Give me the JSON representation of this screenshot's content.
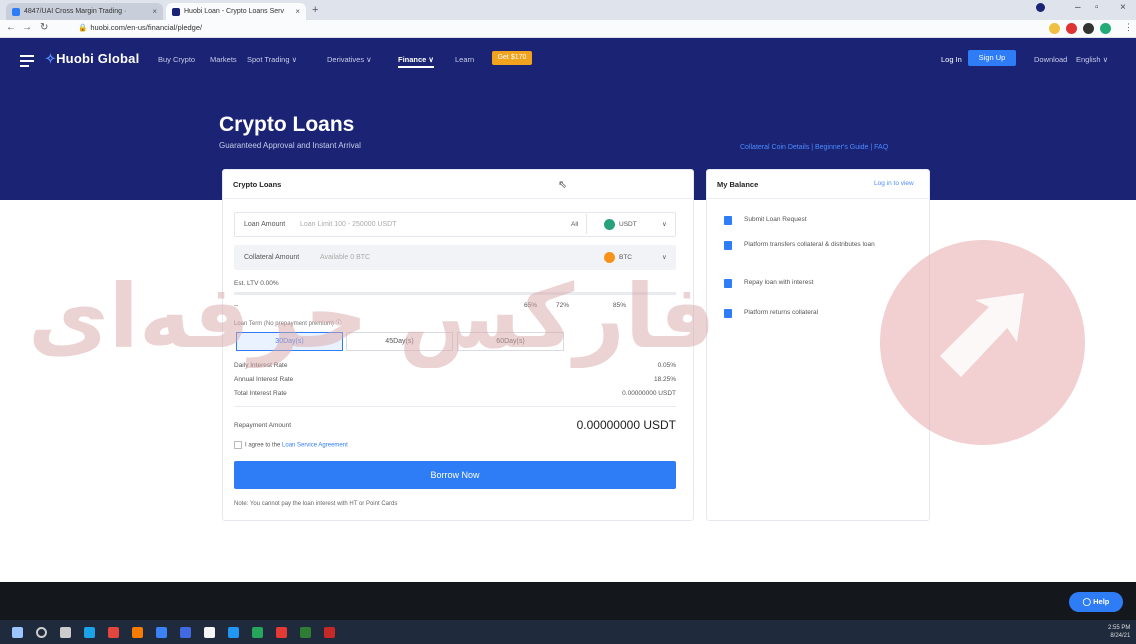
{
  "browser": {
    "tabs": [
      {
        "title": "4847/UAI Cross Margin Trading · ",
        "favicon_color": "#2f7df6"
      },
      {
        "title": "Huobi Loan - Crypto Loans Serv",
        "favicon_color": "#1a2374"
      }
    ],
    "url": "huobi.com/en-us/financial/pledge/"
  },
  "header": {
    "logo_main": "Huobi",
    "logo_sub": "Global",
    "nav": [
      "Buy Crypto",
      "Markets",
      "Spot Trading ∨",
      "Derivatives ∨",
      "Finance ∨",
      "Learn"
    ],
    "get_btn": "Get $170",
    "login": "Log In",
    "signup": "Sign Up",
    "download": "Download",
    "language": "English ∨"
  },
  "hero": {
    "title": "Crypto Loans",
    "subtitle": "Guaranteed Approval and Instant Arrival",
    "links": "Collateral Coin Details  |  Beginner's Guide  |  FAQ"
  },
  "loan_card": {
    "title": "Crypto Loans",
    "loan_label": "Loan Amount",
    "loan_placeholder": "Loan Limit 100 - 250000 USDT",
    "loan_all": "All",
    "loan_coin": "USDT",
    "collateral_label": "Collateral Amount",
    "collateral_placeholder": "Available 0 BTC",
    "collateral_coin": "BTC",
    "ltv_label": "Est. LTV 0.00%",
    "slider_left": "--",
    "slider_marks": [
      "65%",
      "72%",
      "85%"
    ],
    "loan_term_label": "Loan Term (No prepayment premium) ⓘ",
    "terms": [
      "30Day(s)",
      "45Day(s)",
      "60Day(s)"
    ],
    "rows": [
      {
        "label": "Daily Interest Rate",
        "value": "0.05%"
      },
      {
        "label": "Annual Interest Rate",
        "value": "18.25%"
      },
      {
        "label": "Total Interest Rate",
        "value": "0.00000000 USDT"
      }
    ],
    "repay_label": "Repayment Amount",
    "repay_value": "0.00000000 USDT",
    "agree_text": "I agree to the ",
    "agree_link": "Loan Service Agreement",
    "borrow_btn": "Borrow Now",
    "note": "Note: You cannot pay the loan interest with HT or Point Cards"
  },
  "balance_card": {
    "title": "My Balance",
    "login_link": "Log in to view",
    "steps": [
      "Submit Loan Request",
      "Platform transfers collateral & distributes loan",
      "Repay loan with interest",
      "Platform returns collateral"
    ]
  },
  "watermark": {
    "text": "فارکس حرفه‌ای"
  },
  "help_btn": "Help",
  "taskbar": {
    "time": "2:55 PM",
    "date": "8/24/21"
  }
}
